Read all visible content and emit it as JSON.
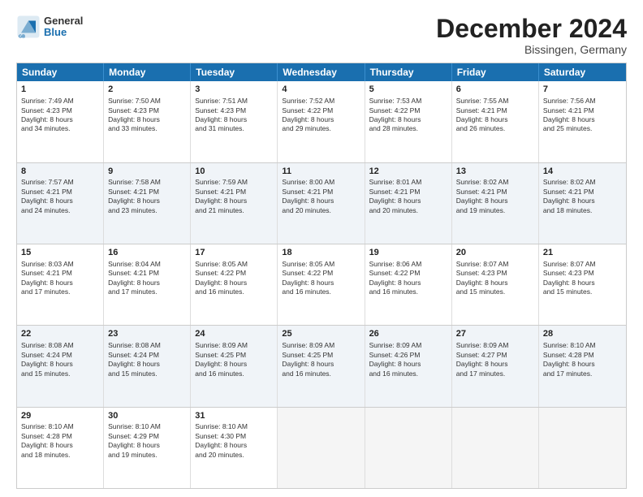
{
  "header": {
    "logo_line1": "General",
    "logo_line2": "Blue",
    "month": "December 2024",
    "location": "Bissingen, Germany"
  },
  "weekdays": [
    "Sunday",
    "Monday",
    "Tuesday",
    "Wednesday",
    "Thursday",
    "Friday",
    "Saturday"
  ],
  "rows": [
    [
      {
        "day": "1",
        "lines": [
          "Sunrise: 7:49 AM",
          "Sunset: 4:23 PM",
          "Daylight: 8 hours",
          "and 34 minutes."
        ]
      },
      {
        "day": "2",
        "lines": [
          "Sunrise: 7:50 AM",
          "Sunset: 4:23 PM",
          "Daylight: 8 hours",
          "and 33 minutes."
        ]
      },
      {
        "day": "3",
        "lines": [
          "Sunrise: 7:51 AM",
          "Sunset: 4:23 PM",
          "Daylight: 8 hours",
          "and 31 minutes."
        ]
      },
      {
        "day": "4",
        "lines": [
          "Sunrise: 7:52 AM",
          "Sunset: 4:22 PM",
          "Daylight: 8 hours",
          "and 29 minutes."
        ]
      },
      {
        "day": "5",
        "lines": [
          "Sunrise: 7:53 AM",
          "Sunset: 4:22 PM",
          "Daylight: 8 hours",
          "and 28 minutes."
        ]
      },
      {
        "day": "6",
        "lines": [
          "Sunrise: 7:55 AM",
          "Sunset: 4:21 PM",
          "Daylight: 8 hours",
          "and 26 minutes."
        ]
      },
      {
        "day": "7",
        "lines": [
          "Sunrise: 7:56 AM",
          "Sunset: 4:21 PM",
          "Daylight: 8 hours",
          "and 25 minutes."
        ]
      }
    ],
    [
      {
        "day": "8",
        "lines": [
          "Sunrise: 7:57 AM",
          "Sunset: 4:21 PM",
          "Daylight: 8 hours",
          "and 24 minutes."
        ]
      },
      {
        "day": "9",
        "lines": [
          "Sunrise: 7:58 AM",
          "Sunset: 4:21 PM",
          "Daylight: 8 hours",
          "and 23 minutes."
        ]
      },
      {
        "day": "10",
        "lines": [
          "Sunrise: 7:59 AM",
          "Sunset: 4:21 PM",
          "Daylight: 8 hours",
          "and 21 minutes."
        ]
      },
      {
        "day": "11",
        "lines": [
          "Sunrise: 8:00 AM",
          "Sunset: 4:21 PM",
          "Daylight: 8 hours",
          "and 20 minutes."
        ]
      },
      {
        "day": "12",
        "lines": [
          "Sunrise: 8:01 AM",
          "Sunset: 4:21 PM",
          "Daylight: 8 hours",
          "and 20 minutes."
        ]
      },
      {
        "day": "13",
        "lines": [
          "Sunrise: 8:02 AM",
          "Sunset: 4:21 PM",
          "Daylight: 8 hours",
          "and 19 minutes."
        ]
      },
      {
        "day": "14",
        "lines": [
          "Sunrise: 8:02 AM",
          "Sunset: 4:21 PM",
          "Daylight: 8 hours",
          "and 18 minutes."
        ]
      }
    ],
    [
      {
        "day": "15",
        "lines": [
          "Sunrise: 8:03 AM",
          "Sunset: 4:21 PM",
          "Daylight: 8 hours",
          "and 17 minutes."
        ]
      },
      {
        "day": "16",
        "lines": [
          "Sunrise: 8:04 AM",
          "Sunset: 4:21 PM",
          "Daylight: 8 hours",
          "and 17 minutes."
        ]
      },
      {
        "day": "17",
        "lines": [
          "Sunrise: 8:05 AM",
          "Sunset: 4:22 PM",
          "Daylight: 8 hours",
          "and 16 minutes."
        ]
      },
      {
        "day": "18",
        "lines": [
          "Sunrise: 8:05 AM",
          "Sunset: 4:22 PM",
          "Daylight: 8 hours",
          "and 16 minutes."
        ]
      },
      {
        "day": "19",
        "lines": [
          "Sunrise: 8:06 AM",
          "Sunset: 4:22 PM",
          "Daylight: 8 hours",
          "and 16 minutes."
        ]
      },
      {
        "day": "20",
        "lines": [
          "Sunrise: 8:07 AM",
          "Sunset: 4:23 PM",
          "Daylight: 8 hours",
          "and 15 minutes."
        ]
      },
      {
        "day": "21",
        "lines": [
          "Sunrise: 8:07 AM",
          "Sunset: 4:23 PM",
          "Daylight: 8 hours",
          "and 15 minutes."
        ]
      }
    ],
    [
      {
        "day": "22",
        "lines": [
          "Sunrise: 8:08 AM",
          "Sunset: 4:24 PM",
          "Daylight: 8 hours",
          "and 15 minutes."
        ]
      },
      {
        "day": "23",
        "lines": [
          "Sunrise: 8:08 AM",
          "Sunset: 4:24 PM",
          "Daylight: 8 hours",
          "and 15 minutes."
        ]
      },
      {
        "day": "24",
        "lines": [
          "Sunrise: 8:09 AM",
          "Sunset: 4:25 PM",
          "Daylight: 8 hours",
          "and 16 minutes."
        ]
      },
      {
        "day": "25",
        "lines": [
          "Sunrise: 8:09 AM",
          "Sunset: 4:25 PM",
          "Daylight: 8 hours",
          "and 16 minutes."
        ]
      },
      {
        "day": "26",
        "lines": [
          "Sunrise: 8:09 AM",
          "Sunset: 4:26 PM",
          "Daylight: 8 hours",
          "and 16 minutes."
        ]
      },
      {
        "day": "27",
        "lines": [
          "Sunrise: 8:09 AM",
          "Sunset: 4:27 PM",
          "Daylight: 8 hours",
          "and 17 minutes."
        ]
      },
      {
        "day": "28",
        "lines": [
          "Sunrise: 8:10 AM",
          "Sunset: 4:28 PM",
          "Daylight: 8 hours",
          "and 17 minutes."
        ]
      }
    ],
    [
      {
        "day": "29",
        "lines": [
          "Sunrise: 8:10 AM",
          "Sunset: 4:28 PM",
          "Daylight: 8 hours",
          "and 18 minutes."
        ]
      },
      {
        "day": "30",
        "lines": [
          "Sunrise: 8:10 AM",
          "Sunset: 4:29 PM",
          "Daylight: 8 hours",
          "and 19 minutes."
        ]
      },
      {
        "day": "31",
        "lines": [
          "Sunrise: 8:10 AM",
          "Sunset: 4:30 PM",
          "Daylight: 8 hours",
          "and 20 minutes."
        ]
      },
      {
        "day": "",
        "lines": []
      },
      {
        "day": "",
        "lines": []
      },
      {
        "day": "",
        "lines": []
      },
      {
        "day": "",
        "lines": []
      }
    ]
  ]
}
